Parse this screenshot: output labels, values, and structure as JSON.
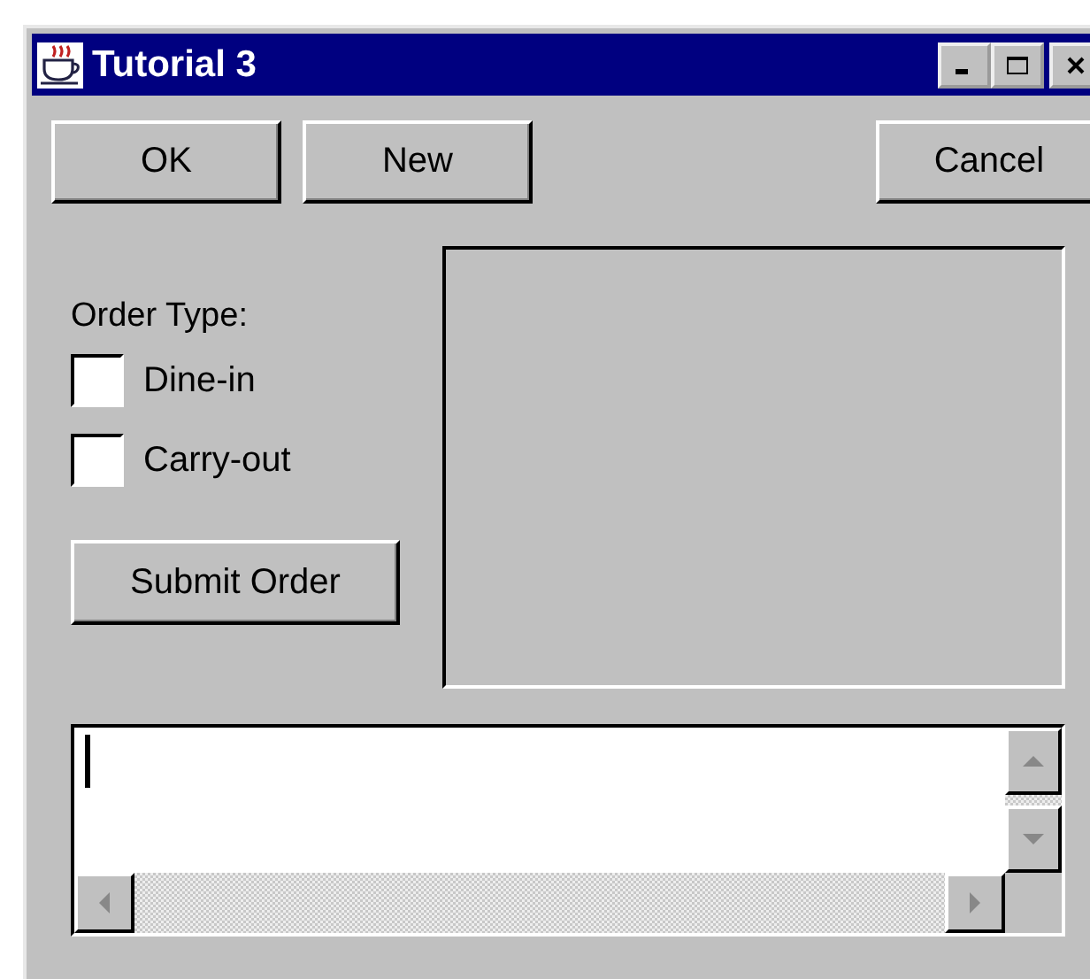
{
  "window": {
    "title": "Tutorial 3"
  },
  "left_buttons": [
    "OK",
    "New"
  ],
  "right_buttons": [
    "Cancel"
  ],
  "order_type": {
    "label": "Order Type:",
    "options": [
      {
        "label": "Dine-in",
        "checked": false
      },
      {
        "label": "Carry-out",
        "checked": false
      }
    ]
  },
  "submit_button": {
    "label": "Submit Order"
  }
}
